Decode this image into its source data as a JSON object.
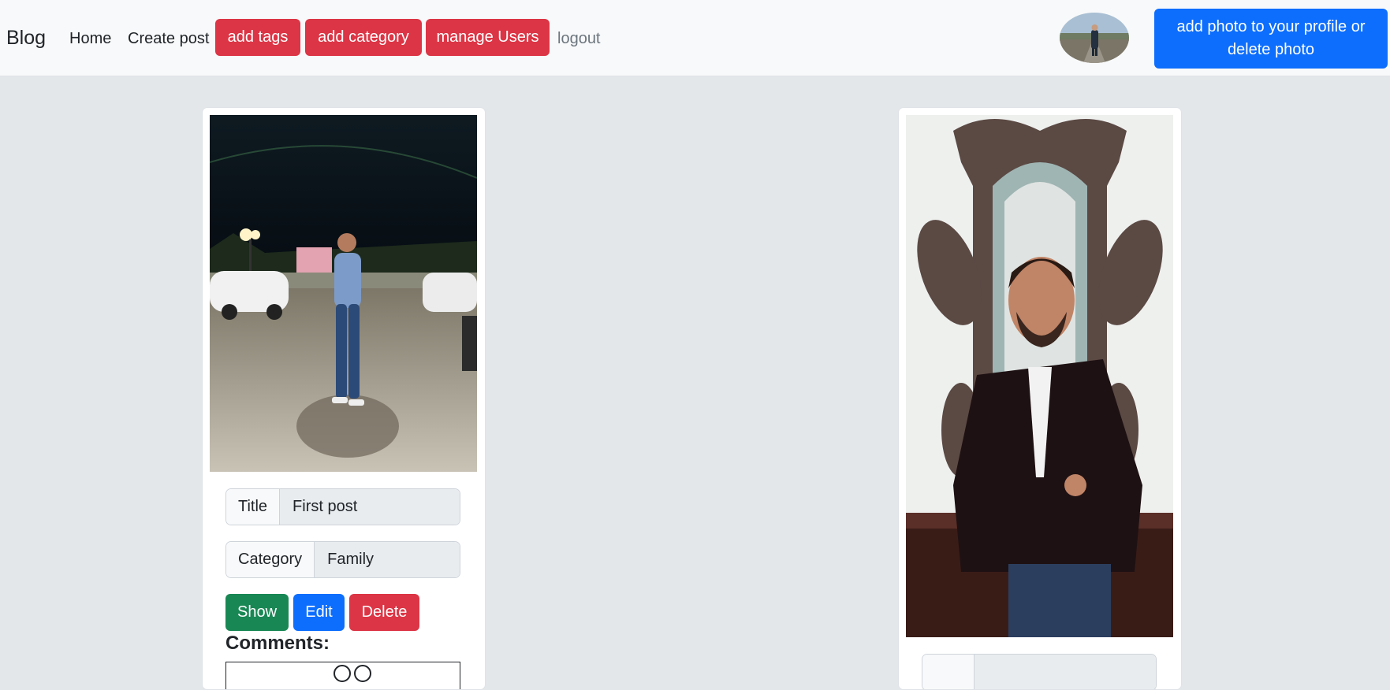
{
  "navbar": {
    "brand": "Blog",
    "links": {
      "home": "Home",
      "create_post": "Create post",
      "logout": "logout"
    },
    "buttons": {
      "add_tags": "add tags",
      "add_category": "add category",
      "manage_users": "manage Users"
    },
    "profile_button": "add photo to your profile or delete photo"
  },
  "posts": [
    {
      "title_label": "Title",
      "title_value": "First post",
      "category_label": "Category",
      "category_value": "Family",
      "actions": {
        "show": "Show",
        "edit": "Edit",
        "delete": "Delete"
      },
      "comments_heading": "Comments:"
    }
  ],
  "colors": {
    "danger": "#dc3545",
    "primary": "#0d6efd",
    "success": "#198754",
    "page_bg": "#e4e7ea",
    "navbar_bg": "#f8f9fa"
  }
}
